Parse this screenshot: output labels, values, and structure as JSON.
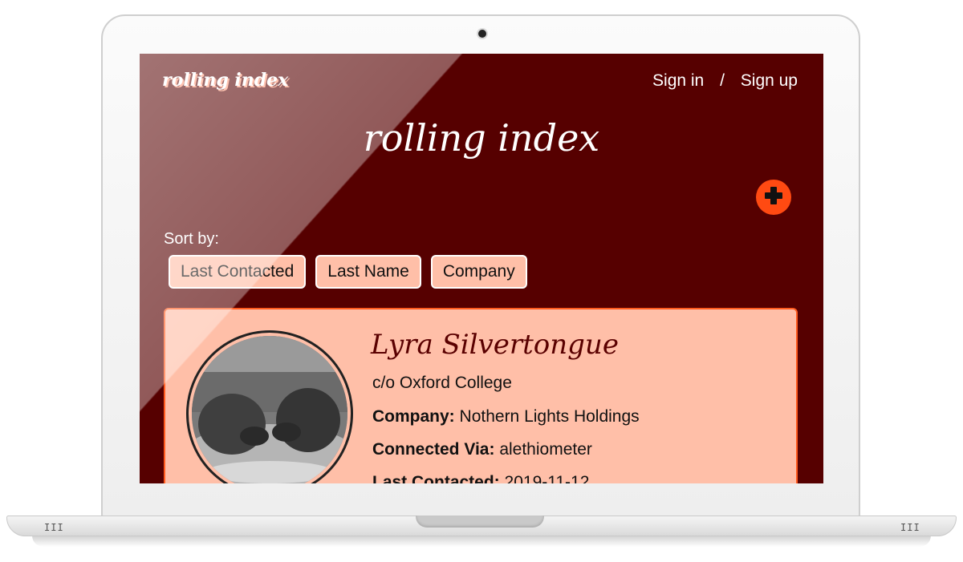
{
  "app": {
    "brand": "rolling index",
    "title": "rolling index"
  },
  "auth": {
    "sign_in": "Sign in",
    "separator": "/",
    "sign_up": "Sign up"
  },
  "add_button": {
    "icon": "plus-icon"
  },
  "sort": {
    "label": "Sort by:",
    "options": [
      "Last Contacted",
      "Last Name",
      "Company"
    ]
  },
  "contact": {
    "name": "Lyra Silvertongue",
    "address": "c/o Oxford College",
    "company_label": "Company:",
    "company": "Nothern Lights Holdings",
    "via_label": "Connected Via:",
    "via": "alethiometer",
    "last_label": "Last Contacted:",
    "last": "2019-11-12"
  },
  "colors": {
    "background": "#560000",
    "card": "#ffbfa8",
    "accent": "#ff4a12",
    "name": "#5a0000"
  },
  "laptop": {
    "vent_left": "III",
    "vent_right": "III"
  }
}
